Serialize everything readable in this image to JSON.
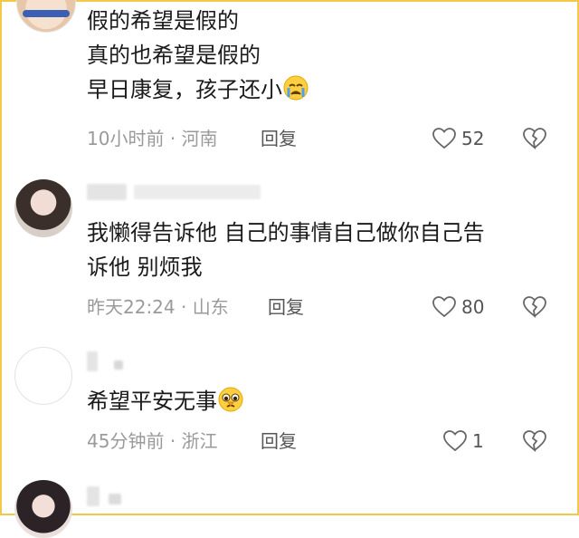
{
  "comments": [
    {
      "lines": [
        "假的希望是假的",
        "真的也希望是假的",
        "早日康复，孩子还小"
      ],
      "emoji": "crying-face",
      "time": "10小时前",
      "location": "河南",
      "reply_label": "回复",
      "likes": "52"
    },
    {
      "lines": [
        "我懒得告诉他 自己的事情自己做你自己告",
        "诉他 别烦我"
      ],
      "time": "昨天22:24",
      "location": "山东",
      "reply_label": "回复",
      "likes": "80"
    },
    {
      "lines": [
        "希望平安无事"
      ],
      "emoji": "pleading-face",
      "time": "45分钟前",
      "location": "浙江",
      "reply_label": "回复",
      "likes": "1"
    }
  ],
  "separator": "·",
  "colors": {
    "border": "#f3c94a",
    "meta_text": "#9a9a9a",
    "action_text": "#555555"
  }
}
